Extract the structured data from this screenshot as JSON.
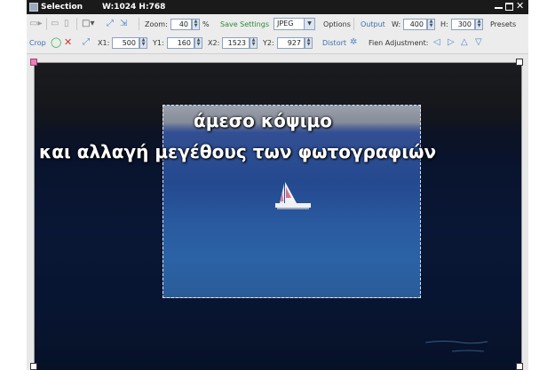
{
  "window": {
    "title": "Selection",
    "dims": "W:1024 H:768"
  },
  "toolbar1": {
    "zoom_label": "Zoom:",
    "zoom_value": "40",
    "zoom_unit": "%",
    "save_settings_label": "Save Settings",
    "format_value": "JPEG",
    "options_label": "Options",
    "output_label": "Output",
    "w_label": "W:",
    "w_value": "400",
    "h_label": "H:",
    "h_value": "300",
    "presets_label": "Presets"
  },
  "toolbar2": {
    "crop_label": "Crop",
    "x1_label": "X1:",
    "x1_value": "500",
    "y1_label": "Y1:",
    "y1_value": "160",
    "x2_label": "X2:",
    "x2_value": "1523",
    "y2_label": "Y2:",
    "y2_value": "927",
    "distort_label": "Distort",
    "fien_label": "Fien Adjustment:"
  },
  "overlay": {
    "line1": "άμεσο κόψιμο",
    "line2": "και αλλαγή μεγέθους των φωτογραφιών"
  },
  "colors": {
    "accent_blue": "#3a6fb0",
    "accent_green": "#2d8a3a",
    "crop_pink": "#e880b8"
  }
}
